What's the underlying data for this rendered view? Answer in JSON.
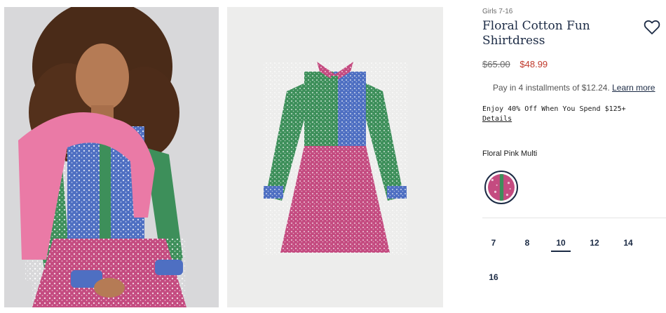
{
  "images": {
    "model_photo": "girl-wearing-floral-shirtdress-photo",
    "product_photo": "floral-shirtdress-flat-photo"
  },
  "product": {
    "category": "Girls 7-16",
    "title": "Floral Cotton Fun Shirtdress",
    "price_original": "$65.00",
    "price_sale": "$48.99",
    "installments_text": "Pay in 4 installments of $12.24.",
    "installments_link": "Learn more",
    "promo_text": "Enjoy 40% Off When You Spend $125+",
    "promo_link": "Details",
    "color_name": "Floral Pink Multi"
  },
  "sizes": [
    "7",
    "8",
    "10",
    "12",
    "14",
    "16"
  ],
  "selected_size": "10",
  "colors": {
    "navy": "#1b2a44",
    "sale_red": "#c0392b",
    "pink": "#d0508a",
    "blue": "#4e6fc2",
    "green": "#3d8f5a"
  },
  "icons": [
    "heart-icon"
  ]
}
